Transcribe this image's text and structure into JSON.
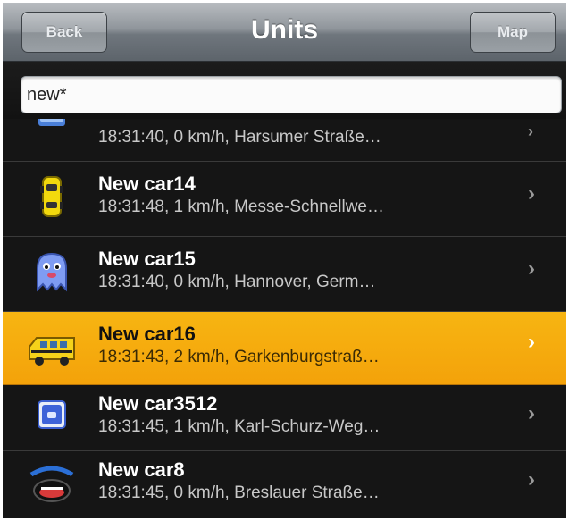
{
  "navbar": {
    "back_label": "Back",
    "title": "Units",
    "map_label": "Map"
  },
  "search": {
    "value": "new*"
  },
  "units": [
    {
      "title": "",
      "subtitle": "18:31:40, 0 km/h, Harsumer Straße…",
      "icon": "blue-car-icon",
      "selected": false
    },
    {
      "title": "New car14",
      "subtitle": "18:31:48, 1 km/h, Messe-Schnellwe…",
      "icon": "yellow-taxi-icon",
      "selected": false
    },
    {
      "title": "New car15",
      "subtitle": "18:31:40, 0 km/h, Hannover, Germ…",
      "icon": "ghost-icon",
      "selected": false
    },
    {
      "title": "New car16",
      "subtitle": "18:31:43, 2 km/h, Garkenburgstraß…",
      "icon": "school-bus-icon",
      "selected": true
    },
    {
      "title": "New car3512",
      "subtitle": "18:31:45, 1 km/h, Karl-Schurz-Weg…",
      "icon": "phone-icon",
      "selected": false
    },
    {
      "title": "New car8",
      "subtitle": "18:31:45, 0 km/h, Breslauer Straße…",
      "icon": "crying-face-icon",
      "selected": false
    }
  ],
  "colors": {
    "selected_row": "#f4a20a",
    "list_background": "#151515",
    "navbar": "#6f767d"
  }
}
